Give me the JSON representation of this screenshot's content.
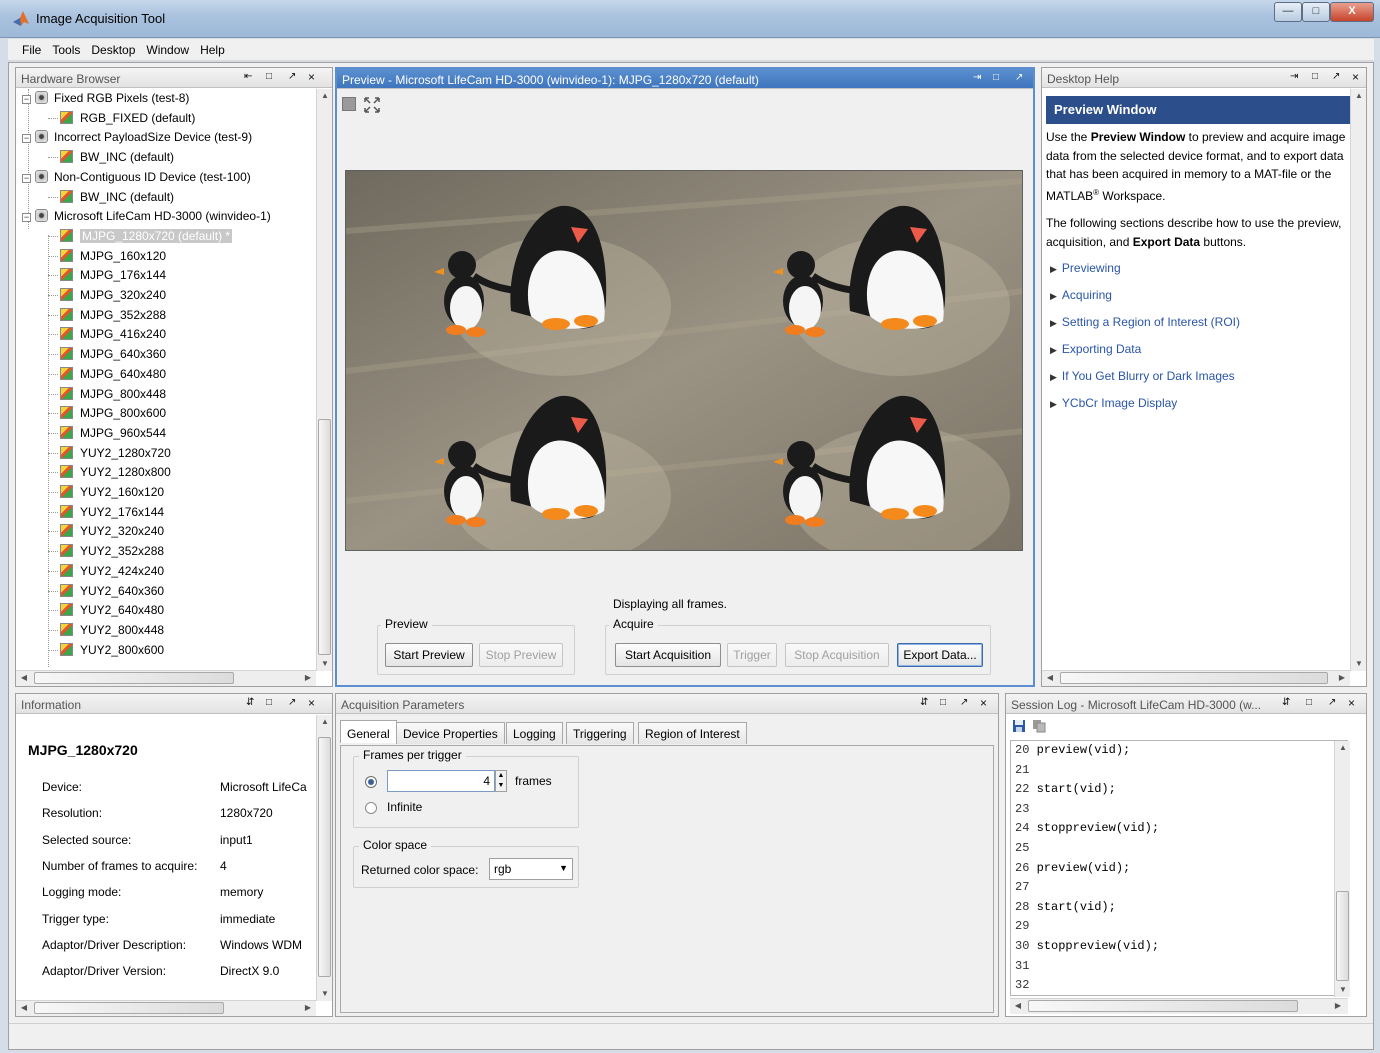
{
  "window": {
    "title": "Image Acquisition Tool",
    "min": "—",
    "max": "□",
    "close": "X"
  },
  "menu": [
    "File",
    "Tools",
    "Desktop",
    "Window",
    "Help"
  ],
  "hardware": {
    "title": "Hardware Browser",
    "controls": [
      "⇤",
      "□",
      "↗",
      "×"
    ],
    "rows": [
      {
        "kind": "device",
        "label": "Fixed RGB Pixels (test-8)"
      },
      {
        "kind": "format",
        "label": "RGB_FIXED (default)"
      },
      {
        "kind": "device",
        "label": "Incorrect PayloadSize Device (test-9)"
      },
      {
        "kind": "format",
        "label": "BW_INC (default)"
      },
      {
        "kind": "device",
        "label": "Non-Contiguous ID Device (test-100)"
      },
      {
        "kind": "format",
        "label": "BW_INC (default)"
      },
      {
        "kind": "device",
        "label": "Microsoft LifeCam HD-3000 (winvideo-1)"
      },
      {
        "kind": "selected",
        "label": "MJPG_1280x720 (default) *"
      },
      {
        "kind": "format",
        "label": "MJPG_160x120"
      },
      {
        "kind": "format",
        "label": "MJPG_176x144"
      },
      {
        "kind": "format",
        "label": "MJPG_320x240"
      },
      {
        "kind": "format",
        "label": "MJPG_352x288"
      },
      {
        "kind": "format",
        "label": "MJPG_416x240"
      },
      {
        "kind": "format",
        "label": "MJPG_640x360"
      },
      {
        "kind": "format",
        "label": "MJPG_640x480"
      },
      {
        "kind": "format",
        "label": "MJPG_800x448"
      },
      {
        "kind": "format",
        "label": "MJPG_800x600"
      },
      {
        "kind": "format",
        "label": "MJPG_960x544"
      },
      {
        "kind": "format",
        "label": "YUY2_1280x720"
      },
      {
        "kind": "format",
        "label": "YUY2_1280x800"
      },
      {
        "kind": "format",
        "label": "YUY2_160x120"
      },
      {
        "kind": "format",
        "label": "YUY2_176x144"
      },
      {
        "kind": "format",
        "label": "YUY2_320x240"
      },
      {
        "kind": "format",
        "label": "YUY2_352x288"
      },
      {
        "kind": "format",
        "label": "YUY2_424x240"
      },
      {
        "kind": "format",
        "label": "YUY2_640x360"
      },
      {
        "kind": "format",
        "label": "YUY2_640x480"
      },
      {
        "kind": "format",
        "label": "YUY2_800x448"
      },
      {
        "kind": "format",
        "label": "YUY2_800x600"
      }
    ]
  },
  "preview": {
    "title": "Preview - Microsoft LifeCam HD-3000 (winvideo-1): MJPG_1280x720 (default)",
    "status": "Displaying all frames.",
    "preview_group": "Preview",
    "acquire_group": "Acquire",
    "start_preview": "Start Preview",
    "stop_preview": "Stop Preview",
    "start_acquisition": "Start Acquisition",
    "trigger": "Trigger",
    "stop_acquisition": "Stop Acquisition",
    "export_data": "Export Data..."
  },
  "help": {
    "title": "Desktop Help",
    "heading": "Preview Window",
    "p1_before": "Use the ",
    "p1_bold": "Preview Window",
    "p1_after": " to preview and acquire image data from the selected device format, and to export data that has been acquired in memory to a MAT-file or the MATLAB",
    "p1_sup": "®",
    "p1_end": " Workspace.",
    "p2_before": "The following sections describe how to use the preview, acquisition, and ",
    "p2_bold": "Export Data",
    "p2_after": " buttons.",
    "links": [
      "Previewing",
      "Acquiring",
      "Setting a Region of Interest (ROI)",
      "Exporting Data",
      "If You Get Blurry or Dark Images",
      "YCbCr Image Display"
    ]
  },
  "info": {
    "title": "Information",
    "heading": "MJPG_1280x720",
    "rows": [
      {
        "label": "Device:",
        "value": "Microsoft LifeCa"
      },
      {
        "label": "Resolution:",
        "value": "1280x720"
      },
      {
        "label": "Selected source:",
        "value": "input1"
      },
      {
        "label": "Number of frames to acquire:",
        "value": "4"
      },
      {
        "label": "Logging mode:",
        "value": "memory"
      },
      {
        "label": "Trigger type:",
        "value": "immediate"
      },
      {
        "label": "Adaptor/Driver Description:",
        "value": "Windows WDM"
      },
      {
        "label": "Adaptor/Driver Version:",
        "value": "DirectX 9.0"
      }
    ]
  },
  "params": {
    "title": "Acquisition Parameters",
    "tabs": [
      "General",
      "Device Properties",
      "Logging",
      "Triggering",
      "Region of Interest"
    ],
    "frames_group": "Frames per trigger",
    "frames_value": "4",
    "frames_unit": "frames",
    "infinite": "Infinite",
    "color_group": "Color space",
    "returned_label": "Returned color space:",
    "color_value": "rgb"
  },
  "log": {
    "title": "Session Log - Microsoft LifeCam HD-3000 (w...",
    "lines": [
      {
        "n": "20",
        "code": "preview(vid);"
      },
      {
        "n": "21",
        "code": ""
      },
      {
        "n": "22",
        "code": "start(vid);"
      },
      {
        "n": "23",
        "code": ""
      },
      {
        "n": "24",
        "code": "stoppreview(vid);"
      },
      {
        "n": "25",
        "code": ""
      },
      {
        "n": "26",
        "code": "preview(vid);"
      },
      {
        "n": "27",
        "code": ""
      },
      {
        "n": "28",
        "code": "start(vid);"
      },
      {
        "n": "29",
        "code": ""
      },
      {
        "n": "30",
        "code": "stoppreview(vid);"
      },
      {
        "n": "31",
        "code": ""
      },
      {
        "n": "32",
        "code": ""
      }
    ]
  },
  "colors": {
    "accent": "#3f75bd",
    "link": "#2a55a8",
    "help_heading": "#2c4f8c"
  }
}
